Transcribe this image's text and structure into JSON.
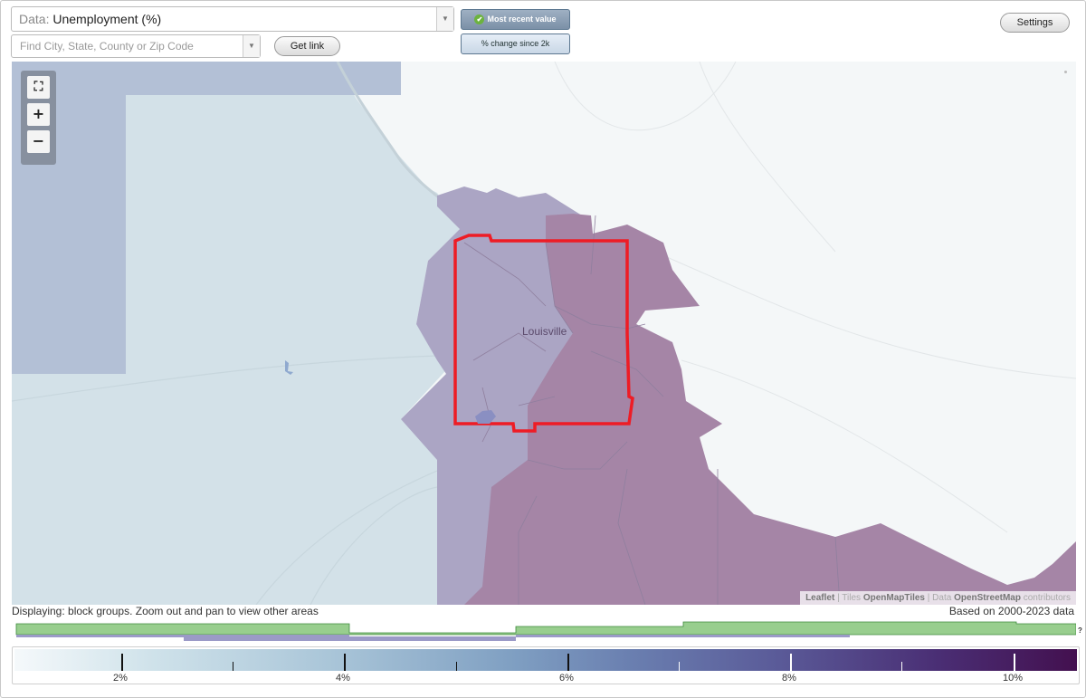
{
  "controls": {
    "data_prefix": "Data: ",
    "data_value": "Unemployment (%)",
    "search_placeholder": "Find City, State, County or Zip Code",
    "get_link_label": "Get link",
    "toggle_active_label": "Most recent value",
    "toggle_inactive_label": "% change since 2k",
    "settings_label": "Settings",
    "dropdown_arrow": "▼"
  },
  "map": {
    "place_label": "Louisville",
    "zoom_buttons": [
      "fullscreen",
      "+",
      "−"
    ],
    "attribution": {
      "leaflet": "Leaflet",
      "sep": " | ",
      "tiles_prefix": "Tiles ",
      "tiles": "OpenMapTiles",
      "data_prefix": "Data ",
      "data": "OpenStreetMap",
      "contributors": " contributors"
    },
    "colors": {
      "low": "#d3e1e8",
      "mid": "#aba5c4",
      "high": "#a585a6",
      "selection": "#ee1c25"
    }
  },
  "footer": {
    "status": "Displaying: block groups. Zoom out and pan to view other areas",
    "based_on": "Based on 2000-2023 data",
    "histogram_help": "?"
  },
  "legend": {
    "tick_labels": [
      "2%",
      "4%",
      "6%",
      "8%",
      "10%"
    ],
    "gradient_start": "#f5f9fb",
    "gradient_end": "#43104f"
  }
}
